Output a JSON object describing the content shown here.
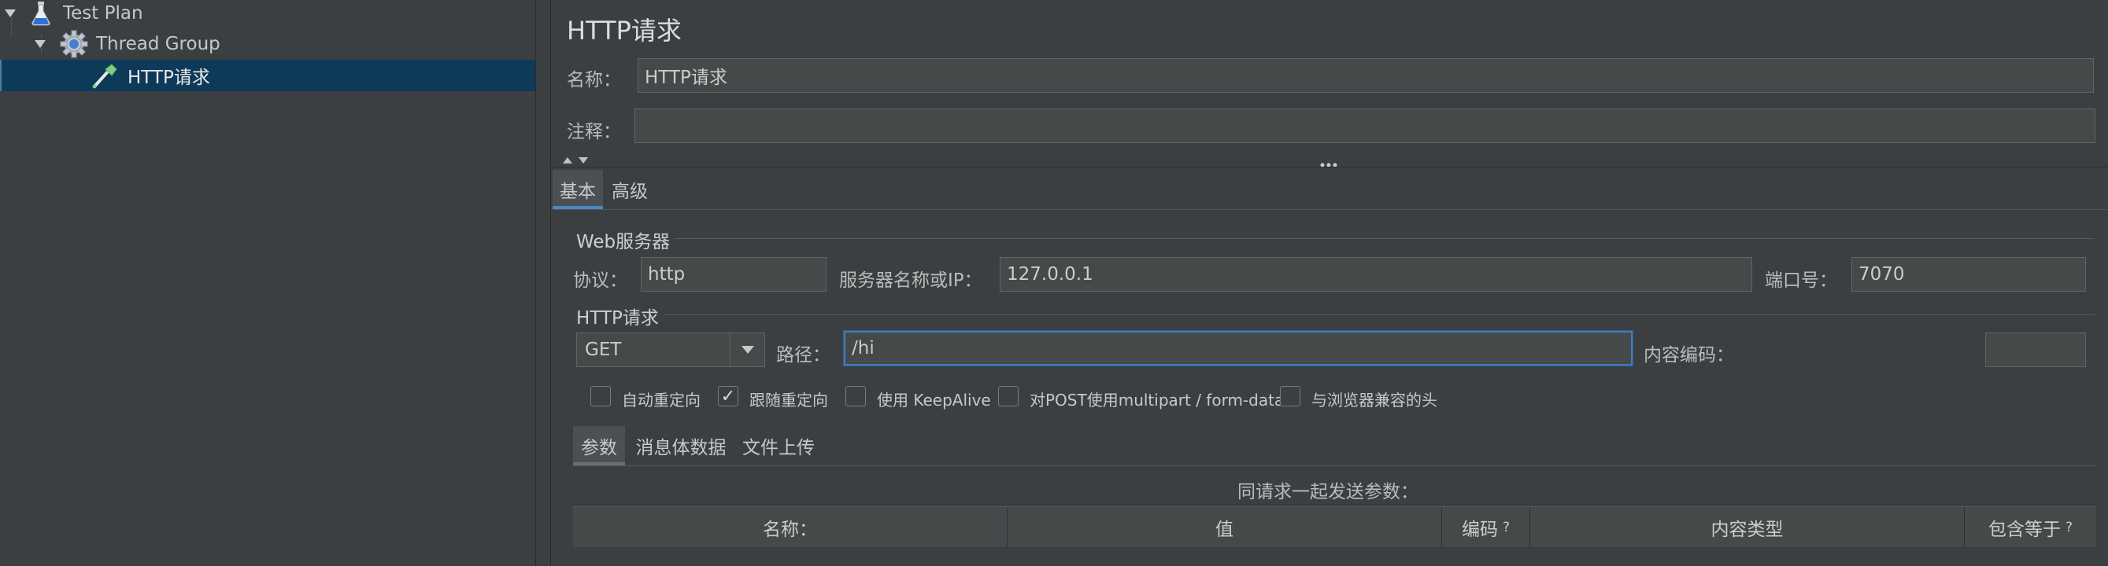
{
  "tree": {
    "items": [
      {
        "label": "Test Plan",
        "icon": "flask-icon"
      },
      {
        "label": "Thread Group",
        "icon": "gear-icon"
      },
      {
        "label": "HTTP请求",
        "icon": "pipette-icon"
      }
    ]
  },
  "panel": {
    "title": "HTTP请求",
    "name_label": "名称：",
    "name_value": "HTTP请求",
    "comment_label": "注释：",
    "comment_value": "",
    "tabs": [
      "基本",
      "高级"
    ],
    "web_server": {
      "group_title": "Web服务器",
      "protocol_label": "协议：",
      "protocol_value": "http",
      "server_label": "服务器名称或IP：",
      "server_value": "127.0.0.1",
      "port_label": "端口号：",
      "port_value": "7070"
    },
    "http_request": {
      "group_title": "HTTP请求",
      "method": "GET",
      "path_label": "路径：",
      "path_value": "/hi",
      "encoding_label": "内容编码：",
      "encoding_value": ""
    },
    "checkboxes": [
      {
        "label": "自动重定向",
        "checked": false
      },
      {
        "label": "跟随重定向",
        "checked": true
      },
      {
        "label": "使用 KeepAlive",
        "checked": false
      },
      {
        "label": "对POST使用multipart / form-data",
        "checked": false
      },
      {
        "label": "与浏览器兼容的头",
        "checked": false
      }
    ],
    "sub_tabs": [
      "参数",
      "消息体数据",
      "文件上传"
    ],
    "params_caption": "同请求一起发送参数：",
    "table_headers": [
      {
        "label": "名称：",
        "hint": ""
      },
      {
        "label": "值",
        "hint": ""
      },
      {
        "label": "编码",
        "hint": "?"
      },
      {
        "label": "内容类型",
        "hint": ""
      },
      {
        "label": "包含等于",
        "hint": "?"
      }
    ]
  }
}
